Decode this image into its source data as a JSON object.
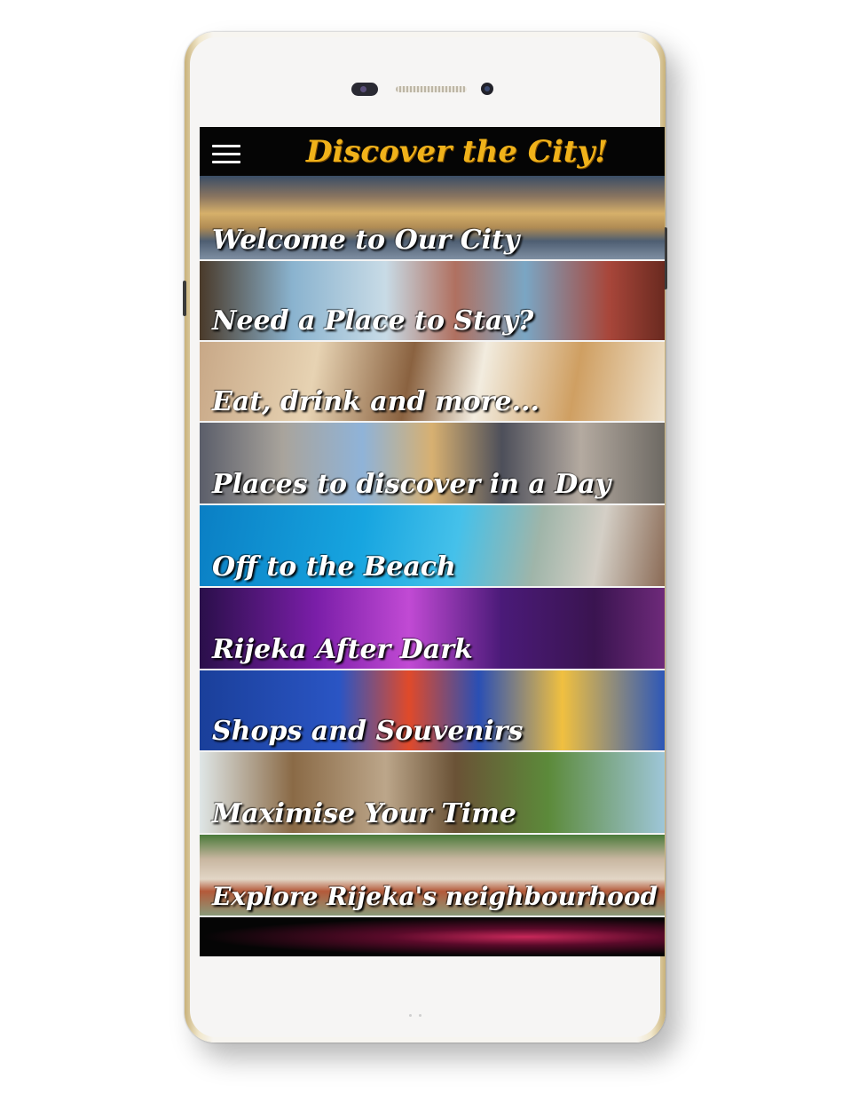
{
  "app": {
    "title": "Discover the City!"
  },
  "menu": {
    "items": [
      {
        "label": "Welcome to Our City"
      },
      {
        "label": "Need a Place to Stay?"
      },
      {
        "label": "Eat, drink and more..."
      },
      {
        "label": "Places to discover in a Day"
      },
      {
        "label": "Off to the Beach"
      },
      {
        "label": "Rijeka After Dark"
      },
      {
        "label": "Shops and Souvenirs"
      },
      {
        "label": "Maximise Your Time"
      },
      {
        "label": "Explore Rijeka's neighbourhood"
      },
      {
        "label": ""
      }
    ]
  },
  "colors": {
    "title": "#f0b21a",
    "topbar": "#050505",
    "label": "#ffffff"
  },
  "icons": {
    "menu": "hamburger-menu-icon"
  }
}
